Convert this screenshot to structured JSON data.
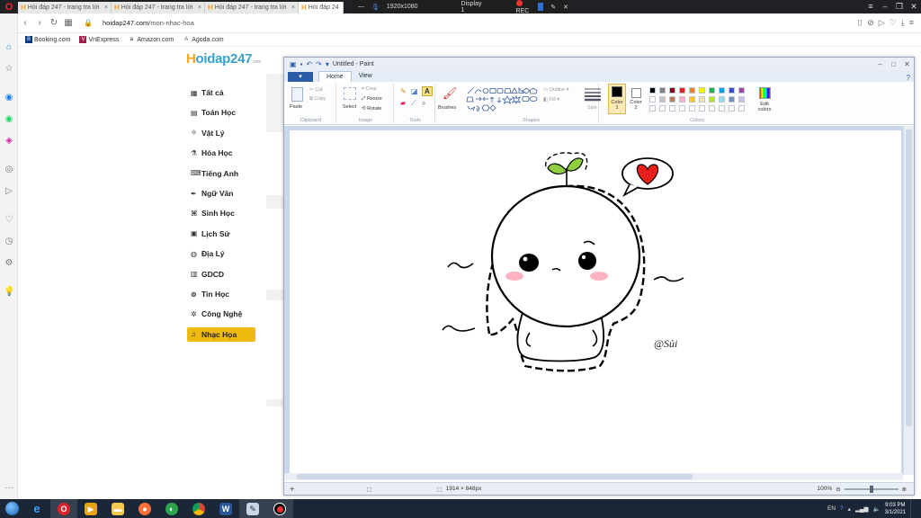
{
  "browser": {
    "tabs": [
      {
        "label": "Hỏi đáp 247 - trang tra lời"
      },
      {
        "label": "Hỏi đáp 247 - trang tra lời"
      },
      {
        "label": "Hỏi đáp 247 - trang tra lời"
      },
      {
        "label": "Hỏi đáp 24"
      }
    ],
    "recorder": {
      "resolution": "1920x1080",
      "display": "Display 1",
      "rec": "REC"
    },
    "url_host": "hoidap247.com",
    "url_path": "/mon-nhac-hoa",
    "bookmarks": [
      "Booking.com",
      "VnExpress",
      "Amazon.com",
      "Agoda.com"
    ]
  },
  "site": {
    "logo_first": "H",
    "logo_rest": "oidap247",
    "logo_suffix": ".com",
    "nav": [
      {
        "label": "Tất cả",
        "icon": "grid-icon"
      },
      {
        "label": "Toán Học",
        "icon": "calculator-icon"
      },
      {
        "label": "Vật Lý",
        "icon": "atom-icon"
      },
      {
        "label": "Hóa Học",
        "icon": "flask-icon"
      },
      {
        "label": "Tiếng Anh",
        "icon": "language-icon"
      },
      {
        "label": "Ngữ Văn",
        "icon": "pen-icon"
      },
      {
        "label": "Sinh Học",
        "icon": "dna-icon"
      },
      {
        "label": "Lịch Sử",
        "icon": "scroll-icon"
      },
      {
        "label": "Địa Lý",
        "icon": "globe-icon"
      },
      {
        "label": "GDCD",
        "icon": "book-icon"
      },
      {
        "label": "Tin Học",
        "icon": "computer-icon"
      },
      {
        "label": "Công Nghệ",
        "icon": "gear-icon"
      },
      {
        "label": "Nhạc Họa",
        "icon": "music-icon"
      }
    ],
    "active_nav": "Nhạc Họa"
  },
  "paint": {
    "title": "Untitled - Paint",
    "file_tab": "▾",
    "tabs": [
      "Home",
      "View"
    ],
    "groups": {
      "clipboard": "Clipboard",
      "image": "Image",
      "tools": "Tools",
      "shapes": "Shapes",
      "colors": "Colors"
    },
    "buttons": {
      "paste": "Paste",
      "cut": "Cut",
      "copy": "Copy",
      "select": "Select",
      "crop": "Crop",
      "resize": "Resize",
      "rotate": "Rotate",
      "brushes": "Brushes",
      "outline": "Outline",
      "fill": "Fill",
      "size": "Size",
      "color1": "Color 1",
      "color2": "Color 2",
      "edit_colors": "Edit colors"
    },
    "palette": [
      "#000000",
      "#7f7f7f",
      "#880015",
      "#ed1c24",
      "#ff7f27",
      "#fff200",
      "#22b14c",
      "#00a2e8",
      "#3f48cc",
      "#a349a4",
      "#ffffff",
      "#c3c3c3",
      "#b97a57",
      "#ffaec9",
      "#ffc90e",
      "#efe4b0",
      "#b5e61d",
      "#99d9ea",
      "#7092be",
      "#c8bfe7"
    ],
    "color1_value": "#000000",
    "color2_value": "#ffffff",
    "canvas_signature": "@Sủi",
    "status_size": "1914 × 848px",
    "zoom": "100%"
  },
  "taskbar": {
    "lang": "EN",
    "time": "9:03 PM",
    "date": "3/1/2021"
  }
}
